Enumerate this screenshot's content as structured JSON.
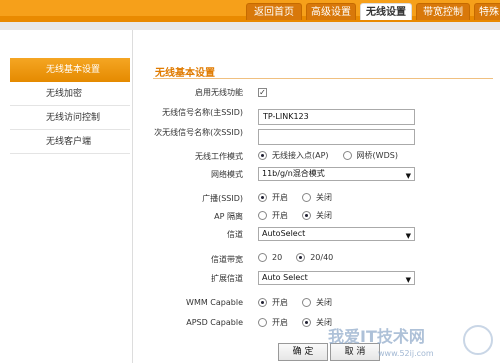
{
  "tabs": [
    {
      "label": "返回首页"
    },
    {
      "label": "高级设置"
    },
    {
      "label": "无线设置"
    },
    {
      "label": "带宽控制"
    },
    {
      "label": "特殊"
    }
  ],
  "sidebar": {
    "items": [
      {
        "label": "无线基本设置"
      },
      {
        "label": "无线加密"
      },
      {
        "label": "无线访问控制"
      },
      {
        "label": "无线客户端"
      }
    ]
  },
  "main": {
    "title": "无线基本设置",
    "enable_wireless": {
      "label": "启用无线功能",
      "checked": true,
      "mark": "✓"
    },
    "ssid": {
      "label": "无线信号名称(主SSID)",
      "value": "TP-LINK123"
    },
    "ssid2": {
      "label": "次无线信号名称(次SSID)",
      "value": ""
    },
    "work_mode": {
      "label": "无线工作模式",
      "options": [
        "无线接入点(AP)",
        "网桥(WDS)"
      ],
      "selected": "无线接入点(AP)"
    },
    "net_mode": {
      "label": "网络模式",
      "value": "11b/g/n混合模式"
    },
    "broadcast": {
      "label": "广播(SSID)",
      "options": [
        "开启",
        "关闭"
      ],
      "selected": "开启"
    },
    "ap_isolation": {
      "label": "AP 隔离",
      "options": [
        "开启",
        "关闭"
      ],
      "selected": "关闭"
    },
    "channel": {
      "label": "信道",
      "value": "AutoSelect"
    },
    "bandwidth": {
      "label": "信道带宽",
      "options": [
        "20",
        "20/40"
      ],
      "selected": "20/40"
    },
    "ext_channel": {
      "label": "扩展信道",
      "value": "Auto Select"
    },
    "wmm": {
      "label": "WMM Capable",
      "options": [
        "开启",
        "关闭"
      ],
      "selected": "开启"
    },
    "apsd": {
      "label": "APSD Capable",
      "options": [
        "开启",
        "关闭"
      ],
      "selected": "关闭"
    },
    "ok_button": "确 定",
    "cancel_button": "取 消"
  },
  "watermark": {
    "text": "我爱IT技术网",
    "url": "www.52ij.com"
  },
  "colors": {
    "accent": "#f6a01a",
    "title": "#e07b00"
  }
}
